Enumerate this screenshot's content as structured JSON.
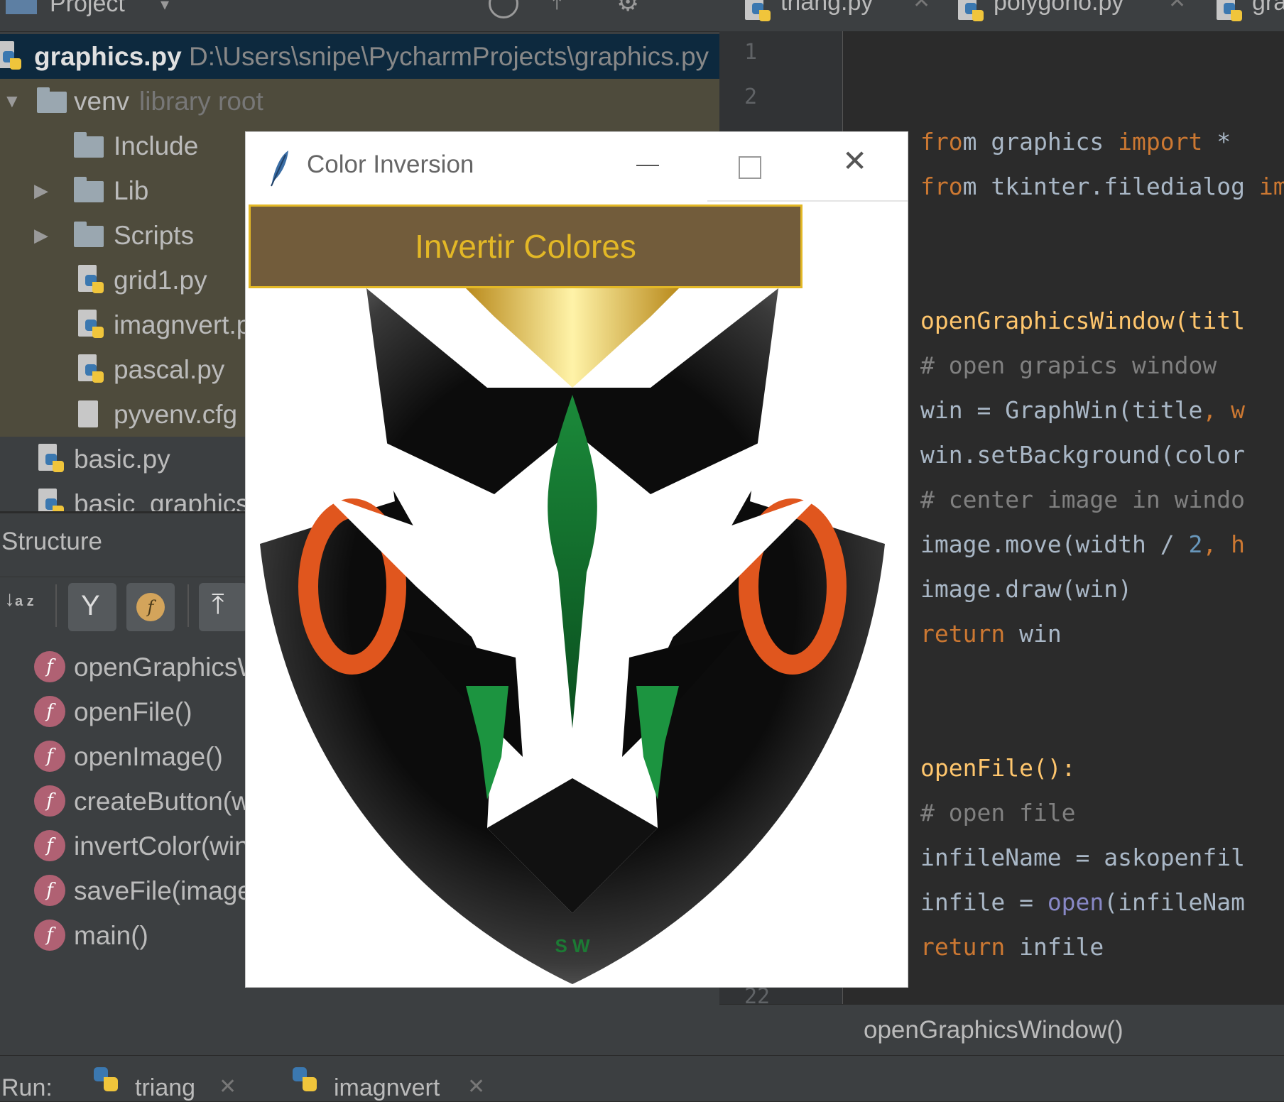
{
  "project_panel": {
    "header_label": "Project",
    "selected_file": {
      "name": "graphics.py",
      "path": "D:\\Users\\snipe\\PycharmProjects\\graphics.py"
    },
    "venv": {
      "name": "venv",
      "hint": "library root"
    },
    "tree": [
      "Include",
      "Lib",
      "Scripts",
      "grid1.py",
      "imagnvert.py",
      "pascal.py",
      "pyvenv.cfg"
    ],
    "files": [
      "basic.py",
      "basic_graphics"
    ]
  },
  "structure": {
    "title": "Structure",
    "sort_icon_label": "a z",
    "items": [
      "openGraphicsWindow()",
      "openFile()",
      "openImage()",
      "createButton(win)",
      "invertColor(win)",
      "saveFile(image)",
      "main()"
    ]
  },
  "editor": {
    "tabs": [
      "triang.py",
      "polygono.py",
      "graphics.py"
    ],
    "line_numbers": {
      "first": "1",
      "second": "2",
      "last": "22"
    },
    "code": {
      "l3_a": "m graphics ",
      "l3_kw": "import",
      "l3_b": " *",
      "l4_a": "m tkinter.filedialog ",
      "l4_kw": "imp",
      "l7": "openGraphicsWindow(titl",
      "l8": "# open grapics window",
      "l9_a": "win = GraphWin(title",
      "l9_b": ", w",
      "l10": "win.setBackground(color",
      "l11": "# center image in windo",
      "l12_a": "image.move(width / ",
      "l12_n": "2",
      "l12_b": ", h",
      "l13": "image.draw(win)",
      "l14_kw": "return",
      "l14_b": " win",
      "l17": "openFile():",
      "l18": "# open file",
      "l19": "infileName = askopenfil",
      "l20_a": "infile = ",
      "l20_bi": "open",
      "l20_b": "(infileNam",
      "l21_kw": "return",
      "l21_b": " infile"
    },
    "breadcrumb": "openGraphicsWindow()"
  },
  "run_bar": {
    "label": "Run:",
    "tabs": [
      "triang",
      "imagnvert"
    ]
  },
  "dialog": {
    "title": "Color Inversion",
    "button_label": "Invertir Colores",
    "logo_initials": "S W"
  },
  "colors": {
    "button_bg": "#725c3b",
    "button_text": "#e3b826",
    "keyword": "#cc7832",
    "function": "#ffc66d"
  }
}
